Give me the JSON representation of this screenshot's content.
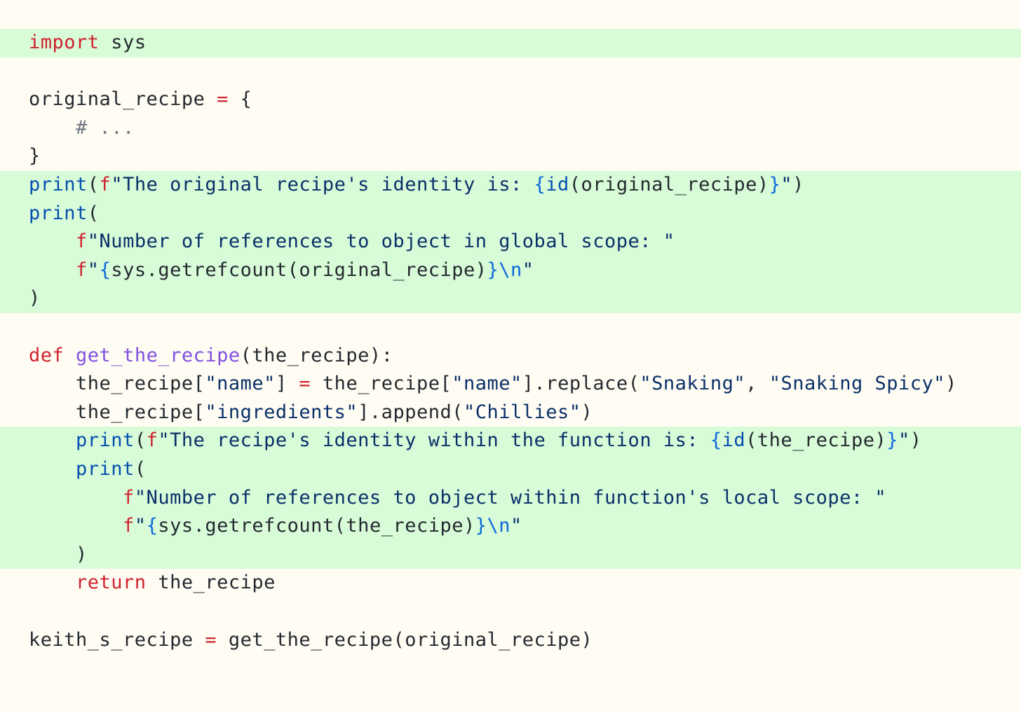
{
  "colors": {
    "background": "#fffcf3",
    "highlight": "#d8fbd8",
    "keyword": "#cf222e",
    "builtin": "#0550ae",
    "string": "#0a3069",
    "interp": "#0969da",
    "funcname": "#8250df",
    "comment": "#6e7781",
    "text": "#24292f"
  },
  "lines": [
    {
      "num": 1,
      "highlighted": true,
      "tokens": [
        {
          "t": "import",
          "c": "kw"
        },
        {
          "t": " sys",
          "c": "plain"
        }
      ]
    },
    {
      "num": 2,
      "highlighted": false,
      "tokens": []
    },
    {
      "num": 3,
      "highlighted": false,
      "tokens": [
        {
          "t": "original_recipe ",
          "c": "plain"
        },
        {
          "t": "=",
          "c": "op"
        },
        {
          "t": " {",
          "c": "plain"
        }
      ]
    },
    {
      "num": 4,
      "highlighted": false,
      "tokens": [
        {
          "t": "    # ...",
          "c": "comment"
        }
      ]
    },
    {
      "num": 5,
      "highlighted": false,
      "tokens": [
        {
          "t": "}",
          "c": "plain"
        }
      ]
    },
    {
      "num": 6,
      "highlighted": true,
      "tokens": [
        {
          "t": "print",
          "c": "builtin"
        },
        {
          "t": "(",
          "c": "plain"
        },
        {
          "t": "f",
          "c": "kw"
        },
        {
          "t": "\"The original recipe's identity is: ",
          "c": "str"
        },
        {
          "t": "{",
          "c": "interp"
        },
        {
          "t": "id",
          "c": "builtin"
        },
        {
          "t": "(original_recipe)",
          "c": "plain"
        },
        {
          "t": "}",
          "c": "interp"
        },
        {
          "t": "\"",
          "c": "str"
        },
        {
          "t": ")",
          "c": "plain"
        }
      ]
    },
    {
      "num": 7,
      "highlighted": true,
      "tokens": [
        {
          "t": "print",
          "c": "builtin"
        },
        {
          "t": "(",
          "c": "plain"
        }
      ]
    },
    {
      "num": 8,
      "highlighted": true,
      "tokens": [
        {
          "t": "    ",
          "c": "plain"
        },
        {
          "t": "f",
          "c": "kw"
        },
        {
          "t": "\"Number of references to object in global scope: \"",
          "c": "str"
        }
      ]
    },
    {
      "num": 9,
      "highlighted": true,
      "tokens": [
        {
          "t": "    ",
          "c": "plain"
        },
        {
          "t": "f",
          "c": "kw"
        },
        {
          "t": "\"",
          "c": "str"
        },
        {
          "t": "{",
          "c": "interp"
        },
        {
          "t": "sys.getrefcount(original_recipe)",
          "c": "plain"
        },
        {
          "t": "}",
          "c": "interp"
        },
        {
          "t": "\\n",
          "c": "interp"
        },
        {
          "t": "\"",
          "c": "str"
        }
      ]
    },
    {
      "num": 10,
      "highlighted": true,
      "tokens": [
        {
          "t": ")",
          "c": "plain"
        }
      ]
    },
    {
      "num": 11,
      "highlighted": false,
      "tokens": []
    },
    {
      "num": 12,
      "highlighted": false,
      "tokens": [
        {
          "t": "def",
          "c": "kw"
        },
        {
          "t": " ",
          "c": "plain"
        },
        {
          "t": "get_the_recipe",
          "c": "fn"
        },
        {
          "t": "(the_recipe):",
          "c": "plain"
        }
      ]
    },
    {
      "num": 13,
      "highlighted": false,
      "tokens": [
        {
          "t": "    the_recipe[",
          "c": "plain"
        },
        {
          "t": "\"name\"",
          "c": "str"
        },
        {
          "t": "] ",
          "c": "plain"
        },
        {
          "t": "=",
          "c": "op"
        },
        {
          "t": " the_recipe[",
          "c": "plain"
        },
        {
          "t": "\"name\"",
          "c": "str"
        },
        {
          "t": "].replace(",
          "c": "plain"
        },
        {
          "t": "\"Snaking\"",
          "c": "str"
        },
        {
          "t": ", ",
          "c": "plain"
        },
        {
          "t": "\"Snaking Spicy\"",
          "c": "str"
        },
        {
          "t": ")",
          "c": "plain"
        }
      ]
    },
    {
      "num": 14,
      "highlighted": false,
      "tokens": [
        {
          "t": "    the_recipe[",
          "c": "plain"
        },
        {
          "t": "\"ingredients\"",
          "c": "str"
        },
        {
          "t": "].append(",
          "c": "plain"
        },
        {
          "t": "\"Chillies\"",
          "c": "str"
        },
        {
          "t": ")",
          "c": "plain"
        }
      ]
    },
    {
      "num": 15,
      "highlighted": true,
      "tokens": [
        {
          "t": "    ",
          "c": "plain"
        },
        {
          "t": "print",
          "c": "builtin"
        },
        {
          "t": "(",
          "c": "plain"
        },
        {
          "t": "f",
          "c": "kw"
        },
        {
          "t": "\"The recipe's identity within the function is: ",
          "c": "str"
        },
        {
          "t": "{",
          "c": "interp"
        },
        {
          "t": "id",
          "c": "builtin"
        },
        {
          "t": "(the_recipe)",
          "c": "plain"
        },
        {
          "t": "}",
          "c": "interp"
        },
        {
          "t": "\"",
          "c": "str"
        },
        {
          "t": ")",
          "c": "plain"
        }
      ]
    },
    {
      "num": 16,
      "highlighted": true,
      "tokens": [
        {
          "t": "    ",
          "c": "plain"
        },
        {
          "t": "print",
          "c": "builtin"
        },
        {
          "t": "(",
          "c": "plain"
        }
      ]
    },
    {
      "num": 17,
      "highlighted": true,
      "tokens": [
        {
          "t": "        ",
          "c": "plain"
        },
        {
          "t": "f",
          "c": "kw"
        },
        {
          "t": "\"Number of references to object within function's local scope: \"",
          "c": "str"
        }
      ]
    },
    {
      "num": 18,
      "highlighted": true,
      "tokens": [
        {
          "t": "        ",
          "c": "plain"
        },
        {
          "t": "f",
          "c": "kw"
        },
        {
          "t": "\"",
          "c": "str"
        },
        {
          "t": "{",
          "c": "interp"
        },
        {
          "t": "sys.getrefcount(the_recipe)",
          "c": "plain"
        },
        {
          "t": "}",
          "c": "interp"
        },
        {
          "t": "\\n",
          "c": "interp"
        },
        {
          "t": "\"",
          "c": "str"
        }
      ]
    },
    {
      "num": 19,
      "highlighted": true,
      "tokens": [
        {
          "t": "    )",
          "c": "plain"
        }
      ]
    },
    {
      "num": 20,
      "highlighted": false,
      "tokens": [
        {
          "t": "    ",
          "c": "plain"
        },
        {
          "t": "return",
          "c": "kw"
        },
        {
          "t": " the_recipe",
          "c": "plain"
        }
      ]
    },
    {
      "num": 21,
      "highlighted": false,
      "tokens": []
    },
    {
      "num": 22,
      "highlighted": false,
      "tokens": [
        {
          "t": "keith_s_recipe ",
          "c": "plain"
        },
        {
          "t": "=",
          "c": "op"
        },
        {
          "t": " get_the_recipe(original_recipe)",
          "c": "plain"
        }
      ]
    }
  ]
}
